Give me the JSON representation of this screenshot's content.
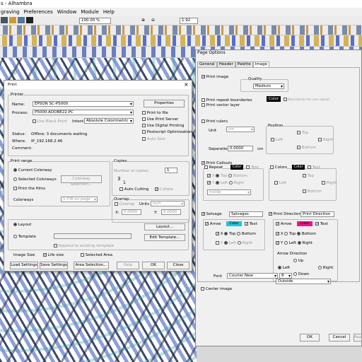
{
  "app": {
    "title": "s - Alhambra",
    "menu": [
      "graving",
      "Preferences",
      "Window",
      "Module",
      "Help"
    ]
  },
  "toolbar": {
    "zoom": "100.00 %",
    "value": "1.92"
  },
  "print": {
    "title": "Print",
    "printer_group": "Printer",
    "name_label": "Name:",
    "name": "EPSON SC-P5000",
    "properties": "Properties",
    "process_label": "Process:",
    "process": "P5000-ADOBE22-PC",
    "use_black_point": "Use Black Point",
    "intent_label": "Intent:",
    "intent": "Absolute Colorimetric",
    "print_to_file": "Print to file",
    "use_print_server": "Use Print Server",
    "use_digital_printing": "Use Digital Printing",
    "postscript": "Postscript Optimization",
    "auto_size": "Auto Size",
    "status_label": "Status:",
    "status": "Offline; 3 documents waiting",
    "where_label": "Where:",
    "where": "IP_192.168.2.46",
    "comment_label": "Comment:",
    "range_group": "Print range",
    "current_colorway": "Current Colorway",
    "selected_colorways": "Selected Colorways",
    "colorway_selection": "Colorway Selection...",
    "print_films": "Print the films",
    "colorways_label": "Colorways",
    "colorways_value": "1 CW on page",
    "copies_group": "Copies",
    "number_of_copies": "Number of copies:",
    "copies_value": "1",
    "collate_num_a": "3",
    "collate_num_b": "1",
    "auto_cutting": "Auto Cutting",
    "collate": "Collate",
    "overlap_group": "Overlap",
    "overlap": "Overlap",
    "units_label": "Units",
    "units": "Inch",
    "x_label": "X:",
    "x_value": "0.0000",
    "y_label": "Y:",
    "y_value": "0.0000",
    "layout_radio": "Layout",
    "template_radio": "Template",
    "layout_btn": "Layout...",
    "edit_template": "Edit Template...",
    "append_template": "Append to existing template",
    "image_size": "Image Size",
    "life_size": "Life size",
    "selected_area": "Selected Area",
    "load_settings": "Load Settings",
    "save_settings": "Save Settings",
    "area_selection": "Area Selection...",
    "help": "Help",
    "ok": "OK",
    "close": "Close"
  },
  "options": {
    "title": "Page Options",
    "tabs": [
      "General",
      "Header",
      "Palette",
      "Image"
    ],
    "print_image": "Print image",
    "quality_label": "Quality",
    "quality": "Medium",
    "print_repeat_boundaries": "Print repeat boundaries",
    "color_btn": "Color",
    "boundaries_for_one_repeat": "Boundaries for one repeat",
    "print_vector_layer": "Print vector layer",
    "print_rulers": "Print rulers",
    "unit_label": "Unit",
    "unit": "cm",
    "position_label": "Position",
    "top": "Top",
    "left": "Left",
    "right": "Right",
    "bottom": "Bottom",
    "separation_label": "Separation",
    "separation": "0.0000",
    "cm": "cm",
    "print_callouts": "Print Callouts",
    "repeat": "Repeat",
    "color": "Color",
    "text": "Text",
    "colors": "Colors",
    "x": "X",
    "y": "Y",
    "inside": "Inside",
    "selvage": "Selvage",
    "selvage_value": "Selvages",
    "print_direction": "Print Direction",
    "print_direction_value": "Print Direction",
    "arrow": "Arrow",
    "arrow_direction": "Arrow Direction",
    "up": "Up",
    "down": "Down",
    "outside": "Outside",
    "font_label": "Font",
    "font": "Courier New",
    "font_size": "8",
    "center_image": "Center image",
    "ok": "OK",
    "cancel": "Cancel",
    "apply": "Apply"
  },
  "colors": {
    "selvage_color": "#1cc7d9",
    "direction_color": "#e5198a",
    "black": "#000000"
  }
}
